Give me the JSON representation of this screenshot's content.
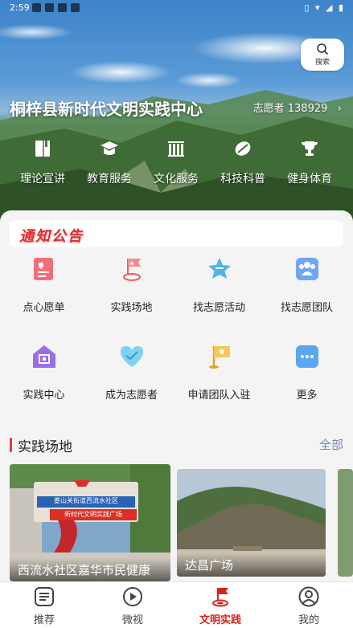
{
  "status_bar": {
    "time": "2:59"
  },
  "hero": {
    "search_label": "搜索",
    "center_title": "桐梓县新时代文明实践中心",
    "volunteer_text": "志愿者 138929",
    "categories": [
      {
        "label": "理论宣讲",
        "icon": "book-icon"
      },
      {
        "label": "教育服务",
        "icon": "graduation-cap-icon"
      },
      {
        "label": "文化服务",
        "icon": "library-icon"
      },
      {
        "label": "科技科普",
        "icon": "satellite-icon"
      },
      {
        "label": "健身体育",
        "icon": "trophy-icon"
      }
    ]
  },
  "notice": {
    "title": "通知公告"
  },
  "services": [
    {
      "label": "点心愿单",
      "icon": "wish-list-icon"
    },
    {
      "label": "实践场地",
      "icon": "flag-location-icon"
    },
    {
      "label": "找志愿活动",
      "icon": "star-icon"
    },
    {
      "label": "找志愿团队",
      "icon": "team-icon"
    },
    {
      "label": "实践中心",
      "icon": "home-scan-icon"
    },
    {
      "label": "成为志愿者",
      "icon": "heart-icon"
    },
    {
      "label": "申请团队入驻",
      "icon": "flag-apply-icon"
    },
    {
      "label": "更多",
      "icon": "more-icon"
    }
  ],
  "venues": {
    "title": "实践场地",
    "more": "全部",
    "cards": [
      {
        "caption": "西流水社区嘉华市民健康",
        "sign_top": "娄山关街道西流水社区",
        "sign_bottom": "新时代文明实践广场"
      },
      {
        "caption": "达昌广场"
      }
    ]
  },
  "bottom_nav": [
    {
      "label": "推荐",
      "icon": "list-icon",
      "active": false
    },
    {
      "label": "微视",
      "icon": "play-icon",
      "active": false
    },
    {
      "label": "文明实践",
      "icon": "practice-flag-icon",
      "active": true
    },
    {
      "label": "我的",
      "icon": "user-icon",
      "active": false
    }
  ],
  "colors": {
    "accent": "#d8231d",
    "notice_red": "#e03030",
    "more_link": "#7a8ba8"
  }
}
